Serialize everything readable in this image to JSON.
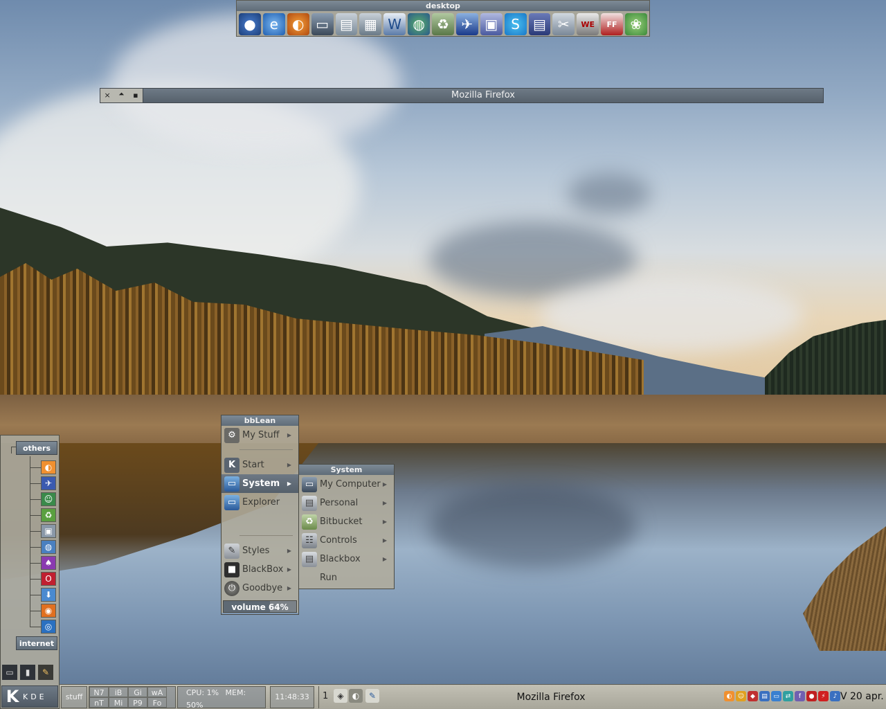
{
  "launchbar": {
    "title": "desktop",
    "icons": [
      "google-earth-icon",
      "internet-explorer-icon",
      "firefox-icon",
      "my-computer-icon",
      "network-icon",
      "network-places-icon",
      "word-document-icon",
      "network-globe-icon",
      "recycle-bin-icon",
      "bird-app-icon",
      "archive-box-icon",
      "skype-icon",
      "floppy-save-icon",
      "tools-icon",
      "winning-eleven-icon",
      "fifa-game-icon",
      "leaf-app-icon"
    ]
  },
  "firefox_window": {
    "title": "Mozilla Firefox",
    "buttons": [
      "×",
      "🞁",
      "▪"
    ]
  },
  "main_menu": {
    "title": "bbLean",
    "items": [
      {
        "label": "My Stuff",
        "icon": "gear-icon"
      },
      {
        "label": "Start",
        "icon": "kde-icon"
      },
      {
        "label": "System",
        "icon": "monitor-icon"
      },
      {
        "label": "Explorer",
        "icon": "monitor-icon"
      },
      {
        "label": "Styles",
        "icon": "styles-icon"
      },
      {
        "label": "BlackBox",
        "icon": "blackbox-icon"
      },
      {
        "label": "Goodbye",
        "icon": "power-icon"
      }
    ],
    "volume_label": "volume 64%",
    "volume_level": 0.64
  },
  "system_menu": {
    "title": "System",
    "items": [
      {
        "label": "My Computer",
        "icon": "my-computer-icon"
      },
      {
        "label": "Personal",
        "icon": "folder-icon"
      },
      {
        "label": "Bitbucket",
        "icon": "recycle-bin-icon"
      },
      {
        "label": "Controls",
        "icon": "controls-icon"
      },
      {
        "label": "Blackbox",
        "icon": "folder-icon"
      },
      {
        "label": "Run",
        "icon": ""
      }
    ]
  },
  "slit": {
    "tabs": [
      "others",
      "internet"
    ],
    "icons": [
      "firefox-icon",
      "bird-app-icon",
      "chat-icon",
      "recycle-bin-icon",
      "trash-icon",
      "network-icon",
      "game-icon",
      "opera-icon",
      "download-icon",
      "orange-app-icon",
      "globe-icon"
    ],
    "bottom_icons": [
      "desktop-icon",
      "terminal-icon",
      "tools-icon"
    ],
    "kde_label": "KDE"
  },
  "taskbar": {
    "stuff_label": "stuff",
    "workspaces_top": [
      "N7",
      "iB",
      "Gi",
      "wA"
    ],
    "workspaces_bottom": [
      "nT",
      "Mi",
      "P9",
      "Fo"
    ],
    "cpu": "CPU: 1%",
    "mem": "MEM: 50%",
    "clock": "11:48:33",
    "desk_number": "1",
    "task_title": "Mozilla Firefox",
    "date": "V 20 apr.",
    "tray_icons": [
      "firefox-icon",
      "smiley-icon",
      "network-diamond-icon",
      "network-icon",
      "display-icon",
      "switch-icon",
      "font-icon",
      "record-icon",
      "flash-icon",
      "volume-icon"
    ]
  }
}
